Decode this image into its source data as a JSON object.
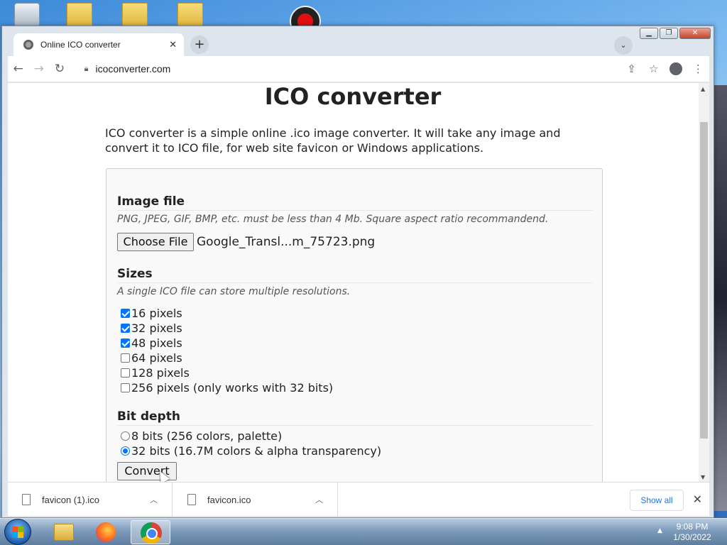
{
  "browser": {
    "tab_title": "Online ICO converter",
    "tab_close": "✕",
    "new_tab": "+",
    "url": "icoconverter.com"
  },
  "icons": {
    "back": "back-arrow-icon",
    "forward": "forward-arrow-icon",
    "reload": "reload-icon",
    "lock": "lock-icon",
    "share": "share-icon",
    "star": "bookmark-star-icon",
    "profile": "profile-icon",
    "menu": "kebab-menu-icon"
  },
  "page": {
    "title": "ICO converter",
    "intro": "ICO converter is a simple online .ico image converter. It will take any image and convert it to ICO file, for web site favicon or Windows applications.",
    "image_file": {
      "title": "Image file",
      "hint": "PNG, JPEG, GIF, BMP, etc. must be less than 4 Mb. Square aspect ratio recommandend.",
      "button": "Choose File",
      "file_name": "Google_Transl...m_75723.png"
    },
    "sizes": {
      "title": "Sizes",
      "hint": "A single ICO file can store multiple resolutions.",
      "options": [
        {
          "label": "16 pixels",
          "checked": true
        },
        {
          "label": "32 pixels",
          "checked": true
        },
        {
          "label": "48 pixels",
          "checked": true
        },
        {
          "label": "64 pixels",
          "checked": false
        },
        {
          "label": "128 pixels",
          "checked": false
        },
        {
          "label": "256 pixels (only works with 32 bits)",
          "checked": false
        }
      ]
    },
    "bit_depth": {
      "title": "Bit depth",
      "options": [
        {
          "label": "8 bits (256 colors, palette)",
          "selected": false
        },
        {
          "label": "32 bits (16.7M colors & alpha transparency)",
          "selected": true
        }
      ]
    },
    "convert_button": "Convert"
  },
  "downloads": {
    "items": [
      {
        "name": "favicon (1).ico"
      },
      {
        "name": "favicon.ico"
      }
    ],
    "show_all": "Show all",
    "close": "✕"
  },
  "taskbar": {
    "time": "9:08 PM",
    "date": "1/30/2022"
  },
  "colors": {
    "accent": "#0075ff",
    "link": "#1a73e8"
  }
}
